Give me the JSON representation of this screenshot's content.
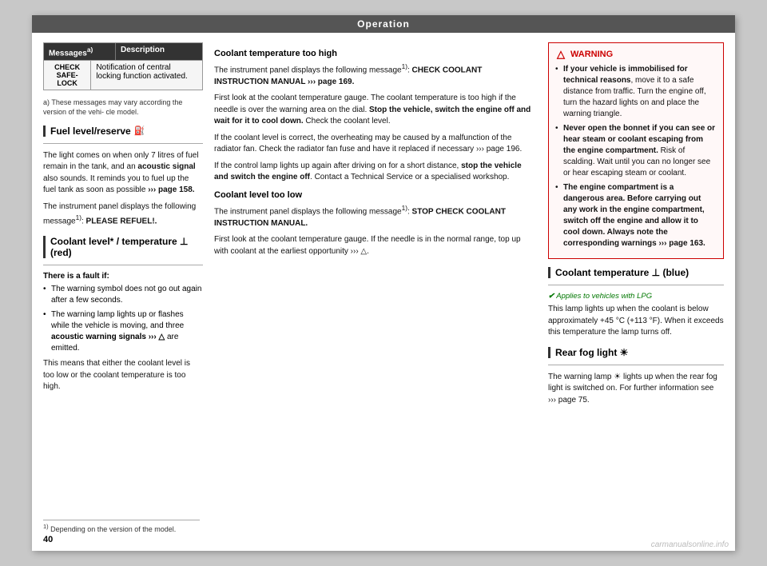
{
  "header": {
    "title": "Operation"
  },
  "page_number": "40",
  "left_column": {
    "table": {
      "headers": [
        "Messagesᵃ)",
        "Description"
      ],
      "rows": [
        {
          "col1": "CHECK SAFE-\nLOCK",
          "col2": "Notification of central locking function activated."
        }
      ]
    },
    "footnote_a": "a)  These messages may vary according the version of the vehi-\ncle model.",
    "fuel_section": {
      "heading": "Fuel level/reserve",
      "icon": "⛽",
      "text": "The light comes on when only 7 litres of fuel remain in the tank, and an acoustic signal also sounds. It reminds you to fuel up the fuel tank as soon as possible ››› page 158.",
      "message_text": "The instrument panel displays the following message¹): PLEASE REFUEL!."
    },
    "coolant_section": {
      "heading": "Coolant level* / temperature",
      "icon": "⊥",
      "icon_color": "(red)",
      "fault_label": "There is a fault if:",
      "bullets": [
        "The warning symbol does not go out again after a few seconds.",
        "The warning lamp lights up or flashes while the vehicle is moving, and three acoustic warning signals ››› ⚠ are emitted."
      ],
      "summary": "This means that either the coolant level is too low or the coolant temperature is too high."
    },
    "footnote_bottom": "¹)  Depending on the version of the model."
  },
  "mid_column": {
    "coolant_too_high": {
      "heading": "Coolant temperature too high",
      "paragraphs": [
        "The instrument panel displays the following message¹): CHECK COOLANT INSTRUCTION MANUAL ››› page 169.",
        "First look at the coolant temperature gauge. The coolant temperature is too high if the needle is over the warning area on the dial. Stop the vehicle, switch the engine off and wait for it to cool down. Check the coolant level.",
        "If the coolant level is correct, the overheating may be caused by a malfunction of the radiator fan. Check the radiator fan fuse and have it replaced if necessary ››› page 196.",
        "If the control lamp lights up again after driving on for a short distance, stop the vehicle and switch the engine off. Contact a Technical Service or a specialised workshop."
      ]
    },
    "coolant_too_low": {
      "heading": "Coolant level too low",
      "paragraphs": [
        "The instrument panel displays the following message¹): STOP CHECK COOLANT INSTRUCTION MANUAL.",
        "First look at the coolant temperature gauge. If the needle is in the normal range, top up with coolant at the earliest opportunity ››› ⚠."
      ]
    }
  },
  "right_column": {
    "warning_box": {
      "title": "WARNING",
      "bullets": [
        "If your vehicle is immobilised for technical reasons, move it to a safe distance from traffic. Turn the engine off, turn the hazard lights on and place the warning triangle.",
        "Never open the bonnet if you can see or hear steam or coolant escaping from the engine compartment. Risk of scalding. Wait until you can no longer see or hear escaping steam or coolant.",
        "The engine compartment is a dangerous area. Before carrying out any work in the engine compartment, switch off the engine and allow it to cool down. Always note the corresponding warnings ››› page 163."
      ]
    },
    "coolant_blue_section": {
      "heading": "Coolant temperature",
      "icon": "⊥",
      "icon_suffix": "(blue)",
      "lpg_note": "✔ Applies to vehicles with LPG",
      "text": "This lamp lights up when the coolant is below approximately +45 ºC (+113 ºF). When it exceeds this temperature the lamp turns off."
    },
    "rear_fog_section": {
      "heading": "Rear fog light",
      "icon": "☀",
      "text": "The warning lamp ★ lights up when the rear fog light is switched on. For further information see ››› page 75."
    }
  },
  "watermark": "carmanualsonline.info"
}
